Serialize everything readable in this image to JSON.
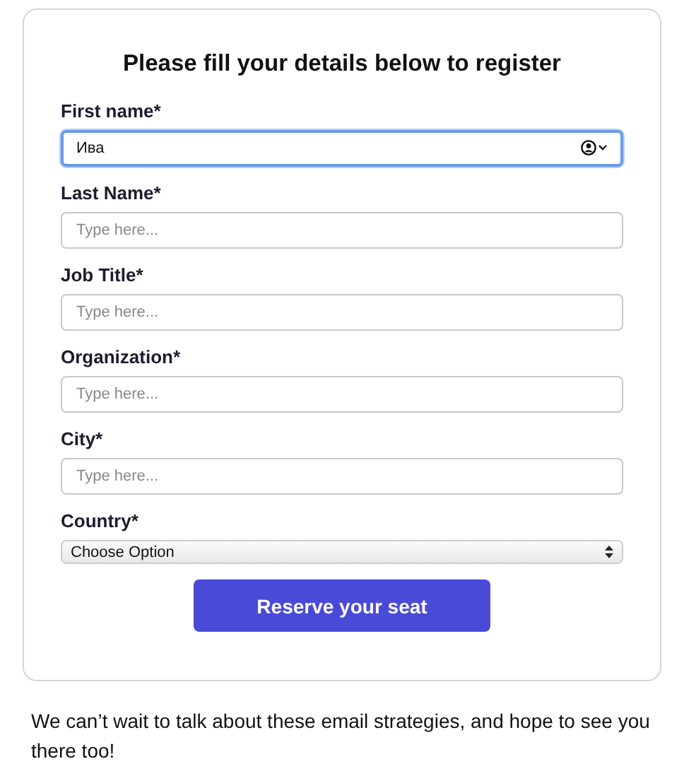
{
  "form": {
    "title": "Please fill your details below to register",
    "fields": [
      {
        "kind": "text",
        "label": "First name*",
        "value": "Ива",
        "focused": true
      },
      {
        "kind": "text",
        "label": "Last Name*",
        "placeholder": "Type here...",
        "focused": false
      },
      {
        "kind": "text",
        "label": "Job Title*",
        "placeholder": "Type here...",
        "focused": false
      },
      {
        "kind": "text",
        "label": "Organization*",
        "placeholder": "Type here...",
        "focused": false
      },
      {
        "kind": "text",
        "label": "City*",
        "placeholder": "Type here...",
        "focused": false
      },
      {
        "kind": "select",
        "label": "Country*",
        "value": "Choose Option",
        "focused": false
      }
    ],
    "submit": "Reserve your seat"
  },
  "footer_text": "We can’t wait to talk about these email strategies, and hope to see you there too!"
}
